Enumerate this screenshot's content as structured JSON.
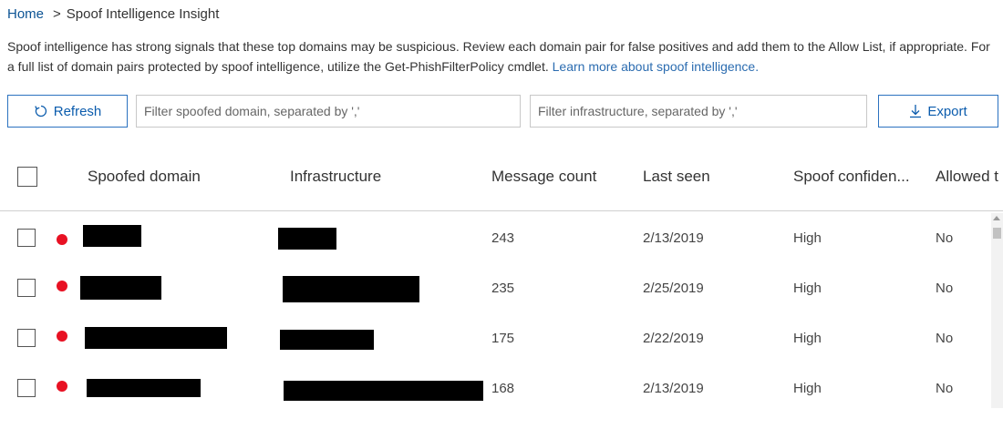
{
  "breadcrumb": {
    "home": "Home",
    "separator": ">",
    "current": "Spoof Intelligence Insight"
  },
  "description": {
    "text": "Spoof intelligence has strong signals that these top domains may be suspicious. Review each domain pair for false positives and add them to the Allow List, if appropriate. For a full list of domain pairs protected by spoof intelligence, utilize the Get-PhishFilterPolicy cmdlet.",
    "link": "Learn more about spoof intelligence."
  },
  "toolbar": {
    "refresh_label": "Refresh",
    "domain_filter_placeholder": "Filter spoofed domain, separated by ','",
    "infra_filter_placeholder": "Filter infrastructure, separated by ','",
    "export_label": "Export"
  },
  "table": {
    "columns": [
      "Spoofed domain",
      "Infrastructure",
      "Message count",
      "Last seen",
      "Spoof confiden...",
      "Allowed t"
    ],
    "rows": [
      {
        "message_count": "243",
        "last_seen": "2/13/2019",
        "spoof_confidence": "High",
        "allowed": "No"
      },
      {
        "message_count": "235",
        "last_seen": "2/25/2019",
        "spoof_confidence": "High",
        "allowed": "No"
      },
      {
        "message_count": "175",
        "last_seen": "2/22/2019",
        "spoof_confidence": "High",
        "allowed": "No"
      },
      {
        "message_count": "168",
        "last_seen": "2/13/2019",
        "spoof_confidence": "High",
        "allowed": "No"
      }
    ]
  },
  "colors": {
    "accent": "#0b5cad",
    "status_dot": "#e81123",
    "redaction": "#000000"
  },
  "icons": {
    "refresh": "refresh-icon",
    "export": "download-icon",
    "status": "red-dot-icon"
  }
}
